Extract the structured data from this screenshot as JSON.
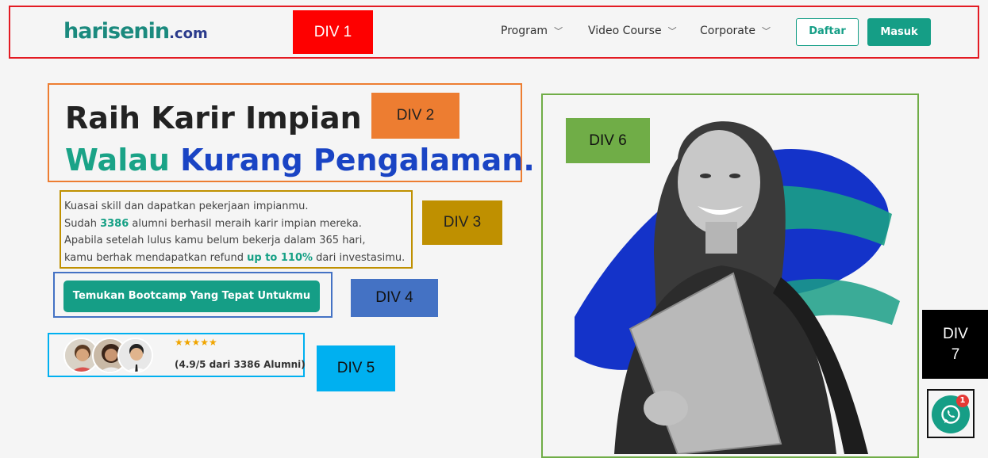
{
  "header": {
    "logo_main": "harisenin",
    "logo_suffix": ".com",
    "nav": [
      {
        "label": "Program"
      },
      {
        "label": "Video Course"
      },
      {
        "label": "Corporate"
      }
    ],
    "daftar": "Daftar",
    "masuk": "Masuk"
  },
  "hero": {
    "title_line1": "Raih Karir Impian",
    "title_line2_a": "Walau",
    "title_line2_b": "Kurang Pengalaman.",
    "desc_line1": "Kuasai skill dan dapatkan pekerjaan impianmu.",
    "desc_line2_a": "Sudah ",
    "desc_line2_num": "3386",
    "desc_line2_b": " alumni berhasil meraih karir impian mereka.",
    "desc_line3": "Apabila setelah lulus kamu belum bekerja dalam 365 hari,",
    "desc_line4_a": "kamu berhak mendapatkan refund ",
    "desc_line4_b": "up to 110%",
    "desc_line4_c": " dari investasimu.",
    "cta": "Temukan Bootcamp Yang Tepat Untukmu",
    "stars": "★★★★★",
    "rating_text": "(4.9/5 dari 3386 Alumni)"
  },
  "labels": {
    "div1": "DIV 1",
    "div2": "DIV 2",
    "div3": "DIV 3",
    "div4": "DIV 4",
    "div5": "DIV 5",
    "div6": "DIV 6",
    "div7a": "DIV",
    "div7b": "7"
  },
  "whatsapp": {
    "badge": "1",
    "icon": "whatsapp-icon"
  },
  "colors": {
    "brand": "#159e86",
    "blue": "#1a44c4"
  }
}
